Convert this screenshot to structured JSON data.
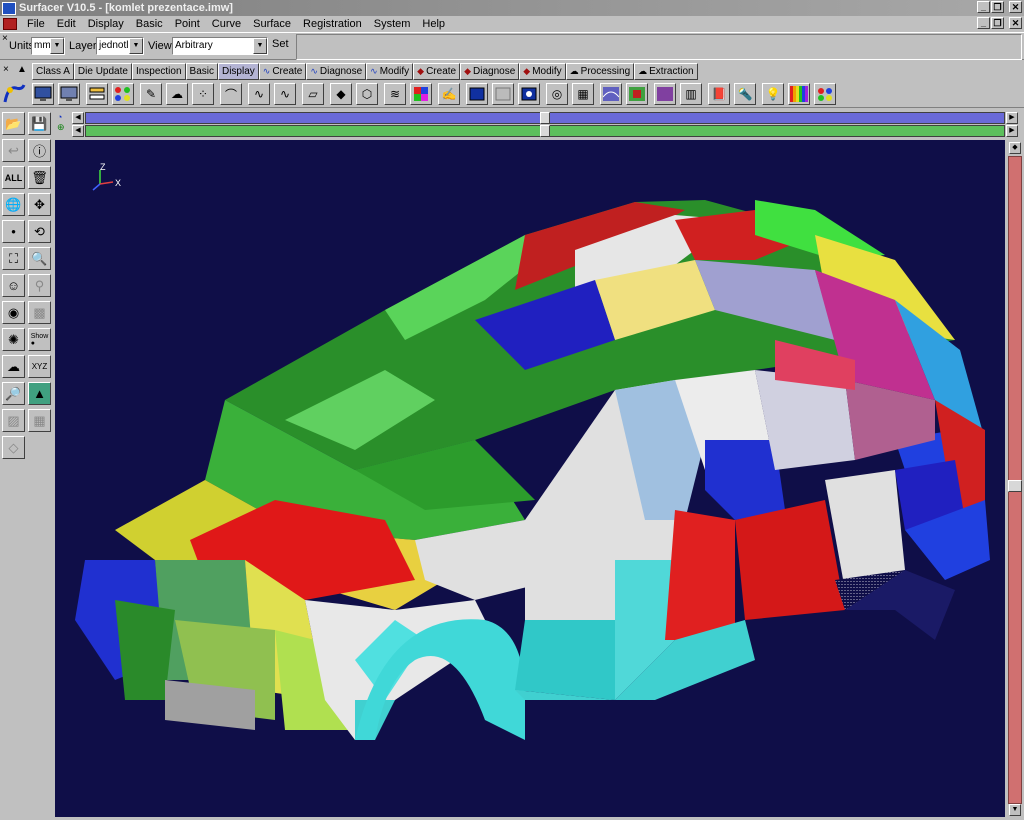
{
  "window": {
    "title": "Surfacer V10.5  - [komlet prezentace.imw]",
    "minimize_glyph": "_",
    "restore_glyph": "❐",
    "close_glyph": "✕"
  },
  "menu": [
    "File",
    "Edit",
    "Display",
    "Basic",
    "Point",
    "Curve",
    "Surface",
    "Registration",
    "System",
    "Help"
  ],
  "units_bar": {
    "units_label": "Units",
    "units_value": "mm",
    "layers_label": "Layers",
    "layers_value": "jednotliv",
    "views_label": "Views",
    "views_value": "Arbitrary",
    "set_label": "Set"
  },
  "tabs": [
    {
      "label": "Class A",
      "icon": ""
    },
    {
      "label": "Die Update",
      "icon": ""
    },
    {
      "label": "Inspection",
      "icon": ""
    },
    {
      "label": "Basic",
      "icon": ""
    },
    {
      "label": "Display",
      "icon": "",
      "active": true
    },
    {
      "label": "Create",
      "icon": "curve-icon"
    },
    {
      "label": "Diagnose",
      "icon": "curve-icon"
    },
    {
      "label": "Modify",
      "icon": "curve-icon"
    },
    {
      "label": "Create",
      "icon": "surface-icon"
    },
    {
      "label": "Diagnose",
      "icon": "surface-icon"
    },
    {
      "label": "Modify",
      "icon": "surface-icon"
    },
    {
      "label": "Processing",
      "icon": "cloud-icon"
    },
    {
      "label": "Extraction",
      "icon": "cloud-icon"
    }
  ],
  "axis_triad": {
    "x": "X",
    "z": "Z"
  },
  "colors": {
    "viewport_bg": "#0f0e48",
    "accent_blue": "#6a6ad8",
    "accent_green": "#5cbf5c",
    "scroll_red": "#d07070"
  }
}
